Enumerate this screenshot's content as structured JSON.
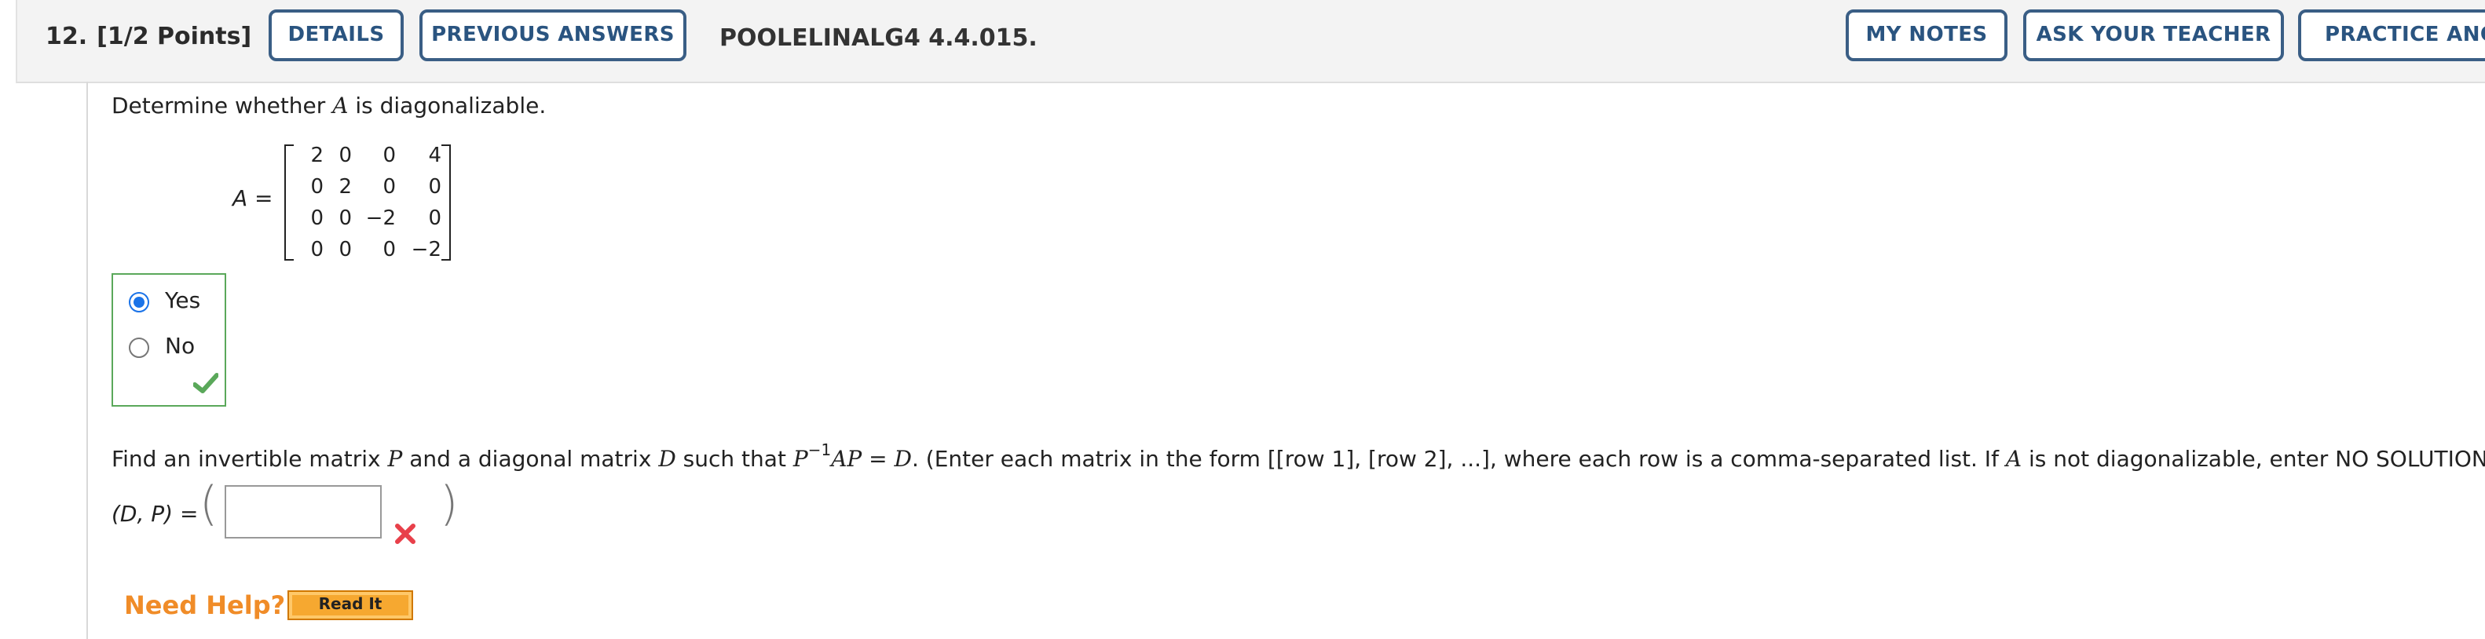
{
  "header": {
    "question_number": "12.",
    "points": "[1/2 Points]",
    "buttons": {
      "details": "DETAILS",
      "previous_answers": "PREVIOUS ANSWERS",
      "my_notes": "MY NOTES",
      "ask_teacher": "ASK YOUR TEACHER",
      "practice": "PRACTICE ANO"
    },
    "question_code": "POOLELINALG4 4.4.015."
  },
  "part1": {
    "statement_pre": "Determine whether ",
    "statement_var": "A",
    "statement_post": " is diagonalizable.",
    "matrix_label": "A =",
    "matrix": [
      [
        "2",
        "0",
        "0",
        "4"
      ],
      [
        "0",
        "2",
        "0",
        "0"
      ],
      [
        "0",
        "0",
        "−2",
        "0"
      ],
      [
        "0",
        "0",
        "0",
        "−2"
      ]
    ],
    "options": [
      {
        "label": "Yes",
        "selected": true
      },
      {
        "label": "No",
        "selected": false
      }
    ],
    "result": "correct"
  },
  "part2": {
    "text_1": "Find an invertible matrix ",
    "var_p": "P",
    "text_2": " and a diagonal matrix ",
    "var_d": "D",
    "text_3": " such that ",
    "expr_p": "P",
    "expr_exp": "−1",
    "expr_ap": "AP",
    "text_4": " = ",
    "expr_d": "D",
    "text_5": ". (Enter each matrix in the form [[row 1], [row 2], ...], where each row is a comma-separated list. If ",
    "var_a": "A",
    "text_6": " is not diagonalizable, enter NO SOLUTION.)",
    "dp_label": "(D, P) =",
    "input_value": "",
    "result": "incorrect"
  },
  "help": {
    "label": "Need Help?",
    "read_it": "Read It"
  },
  "colors": {
    "button_border": "#3a5e85",
    "button_text": "#2a5480",
    "correct": "#5aa85a",
    "incorrect": "#e8404a",
    "help": "#f08c28",
    "radio_selected": "#1a73e8"
  }
}
